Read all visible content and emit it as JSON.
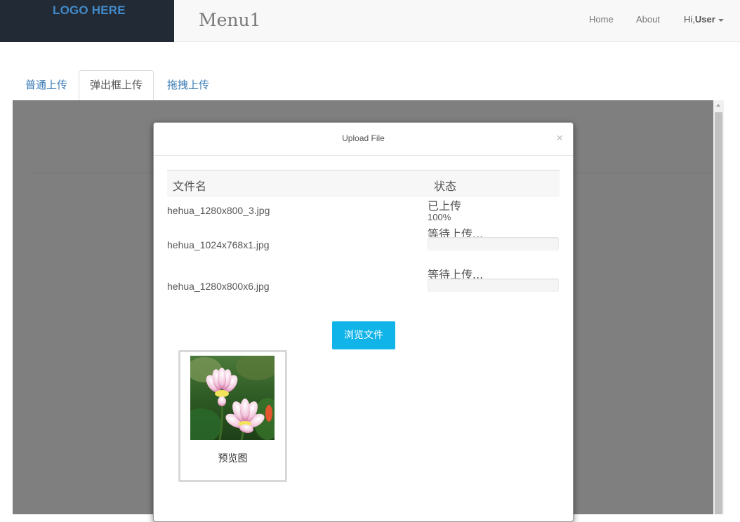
{
  "navbar": {
    "logo": "LOGO HERE",
    "brand": "Menu1",
    "links": {
      "home": "Home",
      "about": "About"
    },
    "user": {
      "greeting": "Hi,",
      "name": "User"
    }
  },
  "tabs": [
    {
      "label": "普通上传",
      "active": false
    },
    {
      "label": "弹出框上传",
      "active": true
    },
    {
      "label": "拖拽上传",
      "active": false
    }
  ],
  "modal": {
    "title": "Upload File",
    "close": "×",
    "columns": {
      "name": "文件名",
      "status": "状态"
    },
    "files": [
      {
        "name": "hehua_1280x800_3.jpg",
        "status": "已上传",
        "progress_text": "100%",
        "progress": 1.0
      },
      {
        "name": "hehua_1024x768x1.jpg",
        "status": "等待上传...",
        "progress": 0
      },
      {
        "name": "hehua_1280x800x6.jpg",
        "status": "等待上传...",
        "progress": 0
      }
    ],
    "browse_label": "浏览文件",
    "preview_caption": "预览图"
  },
  "colors": {
    "accent": "#10b4e8",
    "logo_bg": "#222a35",
    "logo_text": "#428bca",
    "tab_link": "#3a7bb4"
  }
}
